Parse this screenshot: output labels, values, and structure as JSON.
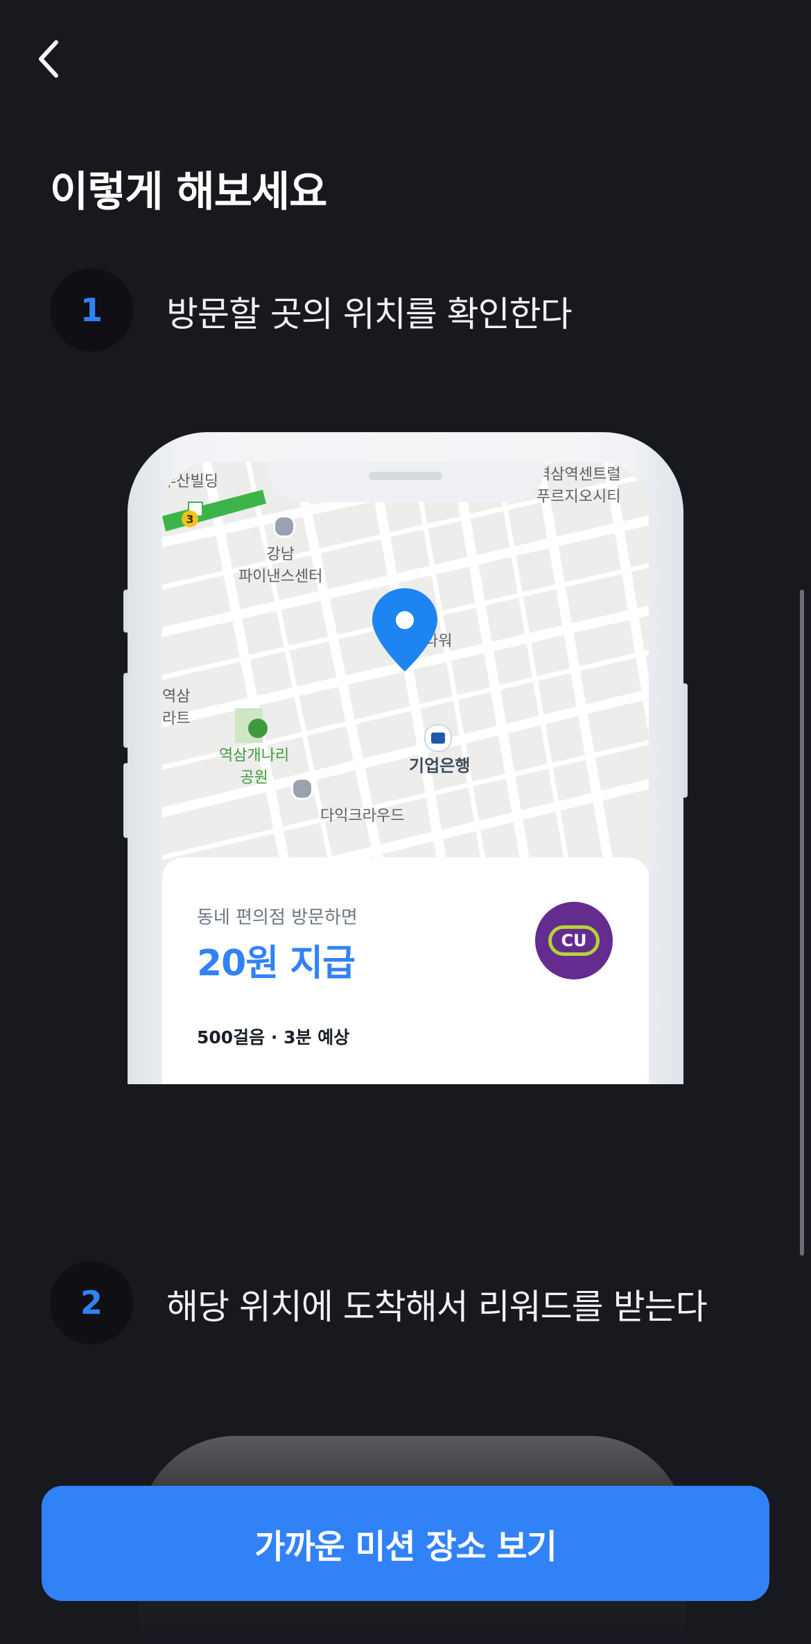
{
  "header": {
    "title": "이렇게 해보세요"
  },
  "steps": [
    {
      "number": "1",
      "text": "방문할 곳의 위치를 확인한다"
    },
    {
      "number": "2",
      "text": "해당 위치에 도착해서 리워드를 받는다"
    }
  ],
  "map": {
    "labels": {
      "top_left": "부산빌딩",
      "station_badge": "3",
      "building": "강남\n파이낸스센터",
      "tower": "타워",
      "left_area": "역삼\n라트",
      "park": "역삼개나리\n공원",
      "bank": "기업은행",
      "cloud": "다익크라우드",
      "top_right": "역삼역센트럴\n푸르지오시티"
    }
  },
  "mission_card": {
    "subtitle": "동네 편의점 방문하면",
    "reward": "20원 지급",
    "meta": "500걸음 · 3분 예상",
    "brand_logo_text": "CU"
  },
  "cta": {
    "label": "가까운 미션 장소 보기"
  },
  "colors": {
    "accent": "#3182f6",
    "background": "#18181f",
    "cu_purple": "#652c8f"
  }
}
